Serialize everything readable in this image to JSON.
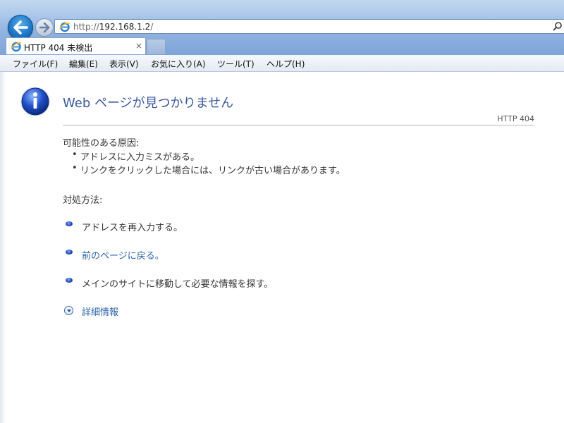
{
  "browser": {
    "address": {
      "prefix": "http://",
      "host": "192.168.1.2",
      "suffix": "/"
    },
    "tab": {
      "title": "HTTP 404 未検出",
      "close": "×"
    }
  },
  "menu": [
    "ファイル(F)",
    "編集(E)",
    "表示(V)",
    "お気に入り(A)",
    "ツール(T)",
    "ヘルプ(H)"
  ],
  "page": {
    "heading": "Web ページが見つかりません",
    "code": "HTTP 404",
    "causes_title": "可能性のある原因:",
    "causes": [
      "アドレスに入力ミスがある。",
      "リンクをクリックした場合には、リンクが古い場合があります。"
    ],
    "remedy_title": "対処方法:",
    "remedies": [
      "アドレスを再入力する。",
      "前のページに戻る。",
      "メインのサイトに移動して必要な情報を探す。"
    ],
    "details": "詳細情報"
  },
  "colors": {
    "heading": "#3a5a9e",
    "link": "#2a63a9",
    "chrome": "#8fb2e0"
  },
  "icons": [
    "back-arrow-icon",
    "forward-arrow-icon",
    "ie-logo-icon",
    "search-icon",
    "info-icon",
    "bullet-icon",
    "expand-icon"
  ]
}
